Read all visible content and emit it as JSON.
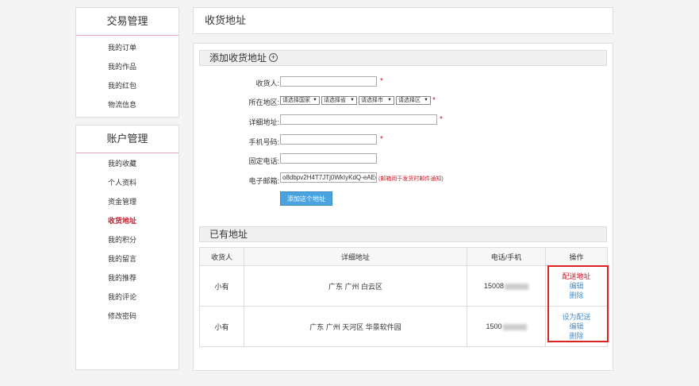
{
  "sidebar": {
    "section1": {
      "title": "交易管理",
      "items": [
        "我的订单",
        "我的作品",
        "我的红包",
        "物流信息"
      ]
    },
    "section2": {
      "title": "账户管理",
      "items": [
        "我的收藏",
        "个人资料",
        "资金管理",
        "收货地址",
        "我的积分",
        "我的留言",
        "我的推荐",
        "我的评论",
        "修改密码"
      ],
      "active": "收货地址"
    }
  },
  "page": {
    "title": "收货地址"
  },
  "form": {
    "title": "添加收货地址",
    "plus_icon": "⊕",
    "fields": {
      "receiver": {
        "label": "收货人:",
        "value": ""
      },
      "region": {
        "label": "所在地区:",
        "selects": [
          "请选择国家",
          "请选择省",
          "请选择市",
          "请选择区"
        ]
      },
      "address": {
        "label": "详细地址:",
        "value": ""
      },
      "mobile": {
        "label": "手机号码:",
        "value": ""
      },
      "phone": {
        "label": "固定电话:",
        "value": ""
      },
      "email": {
        "label": "电子邮箱:",
        "value": "o8dbpv2H4T7JTj0WkIyKdQ-eAEeo@",
        "hint": "(邮箱用于发货时邮件通知)"
      }
    },
    "required_mark": "*",
    "submit_label": "添加这个地址"
  },
  "existing": {
    "title": "已有地址",
    "columns": [
      "收货人",
      "详细地址",
      "电话/手机",
      "操作"
    ],
    "rows": [
      {
        "name": "小有",
        "address": "广东 广州 白云区",
        "phone": "15008",
        "ops": [
          "配送地址",
          "编辑",
          "删除"
        ]
      },
      {
        "name": "小有",
        "address": "广东 广州 天河区  华景软件园",
        "phone": "1500",
        "ops": [
          "设为配送",
          "编辑",
          "删除"
        ]
      }
    ]
  },
  "colors": {
    "accent_red": "#c81c2c",
    "link_blue": "#4a8fc9",
    "button_blue": "#4aa3de"
  }
}
